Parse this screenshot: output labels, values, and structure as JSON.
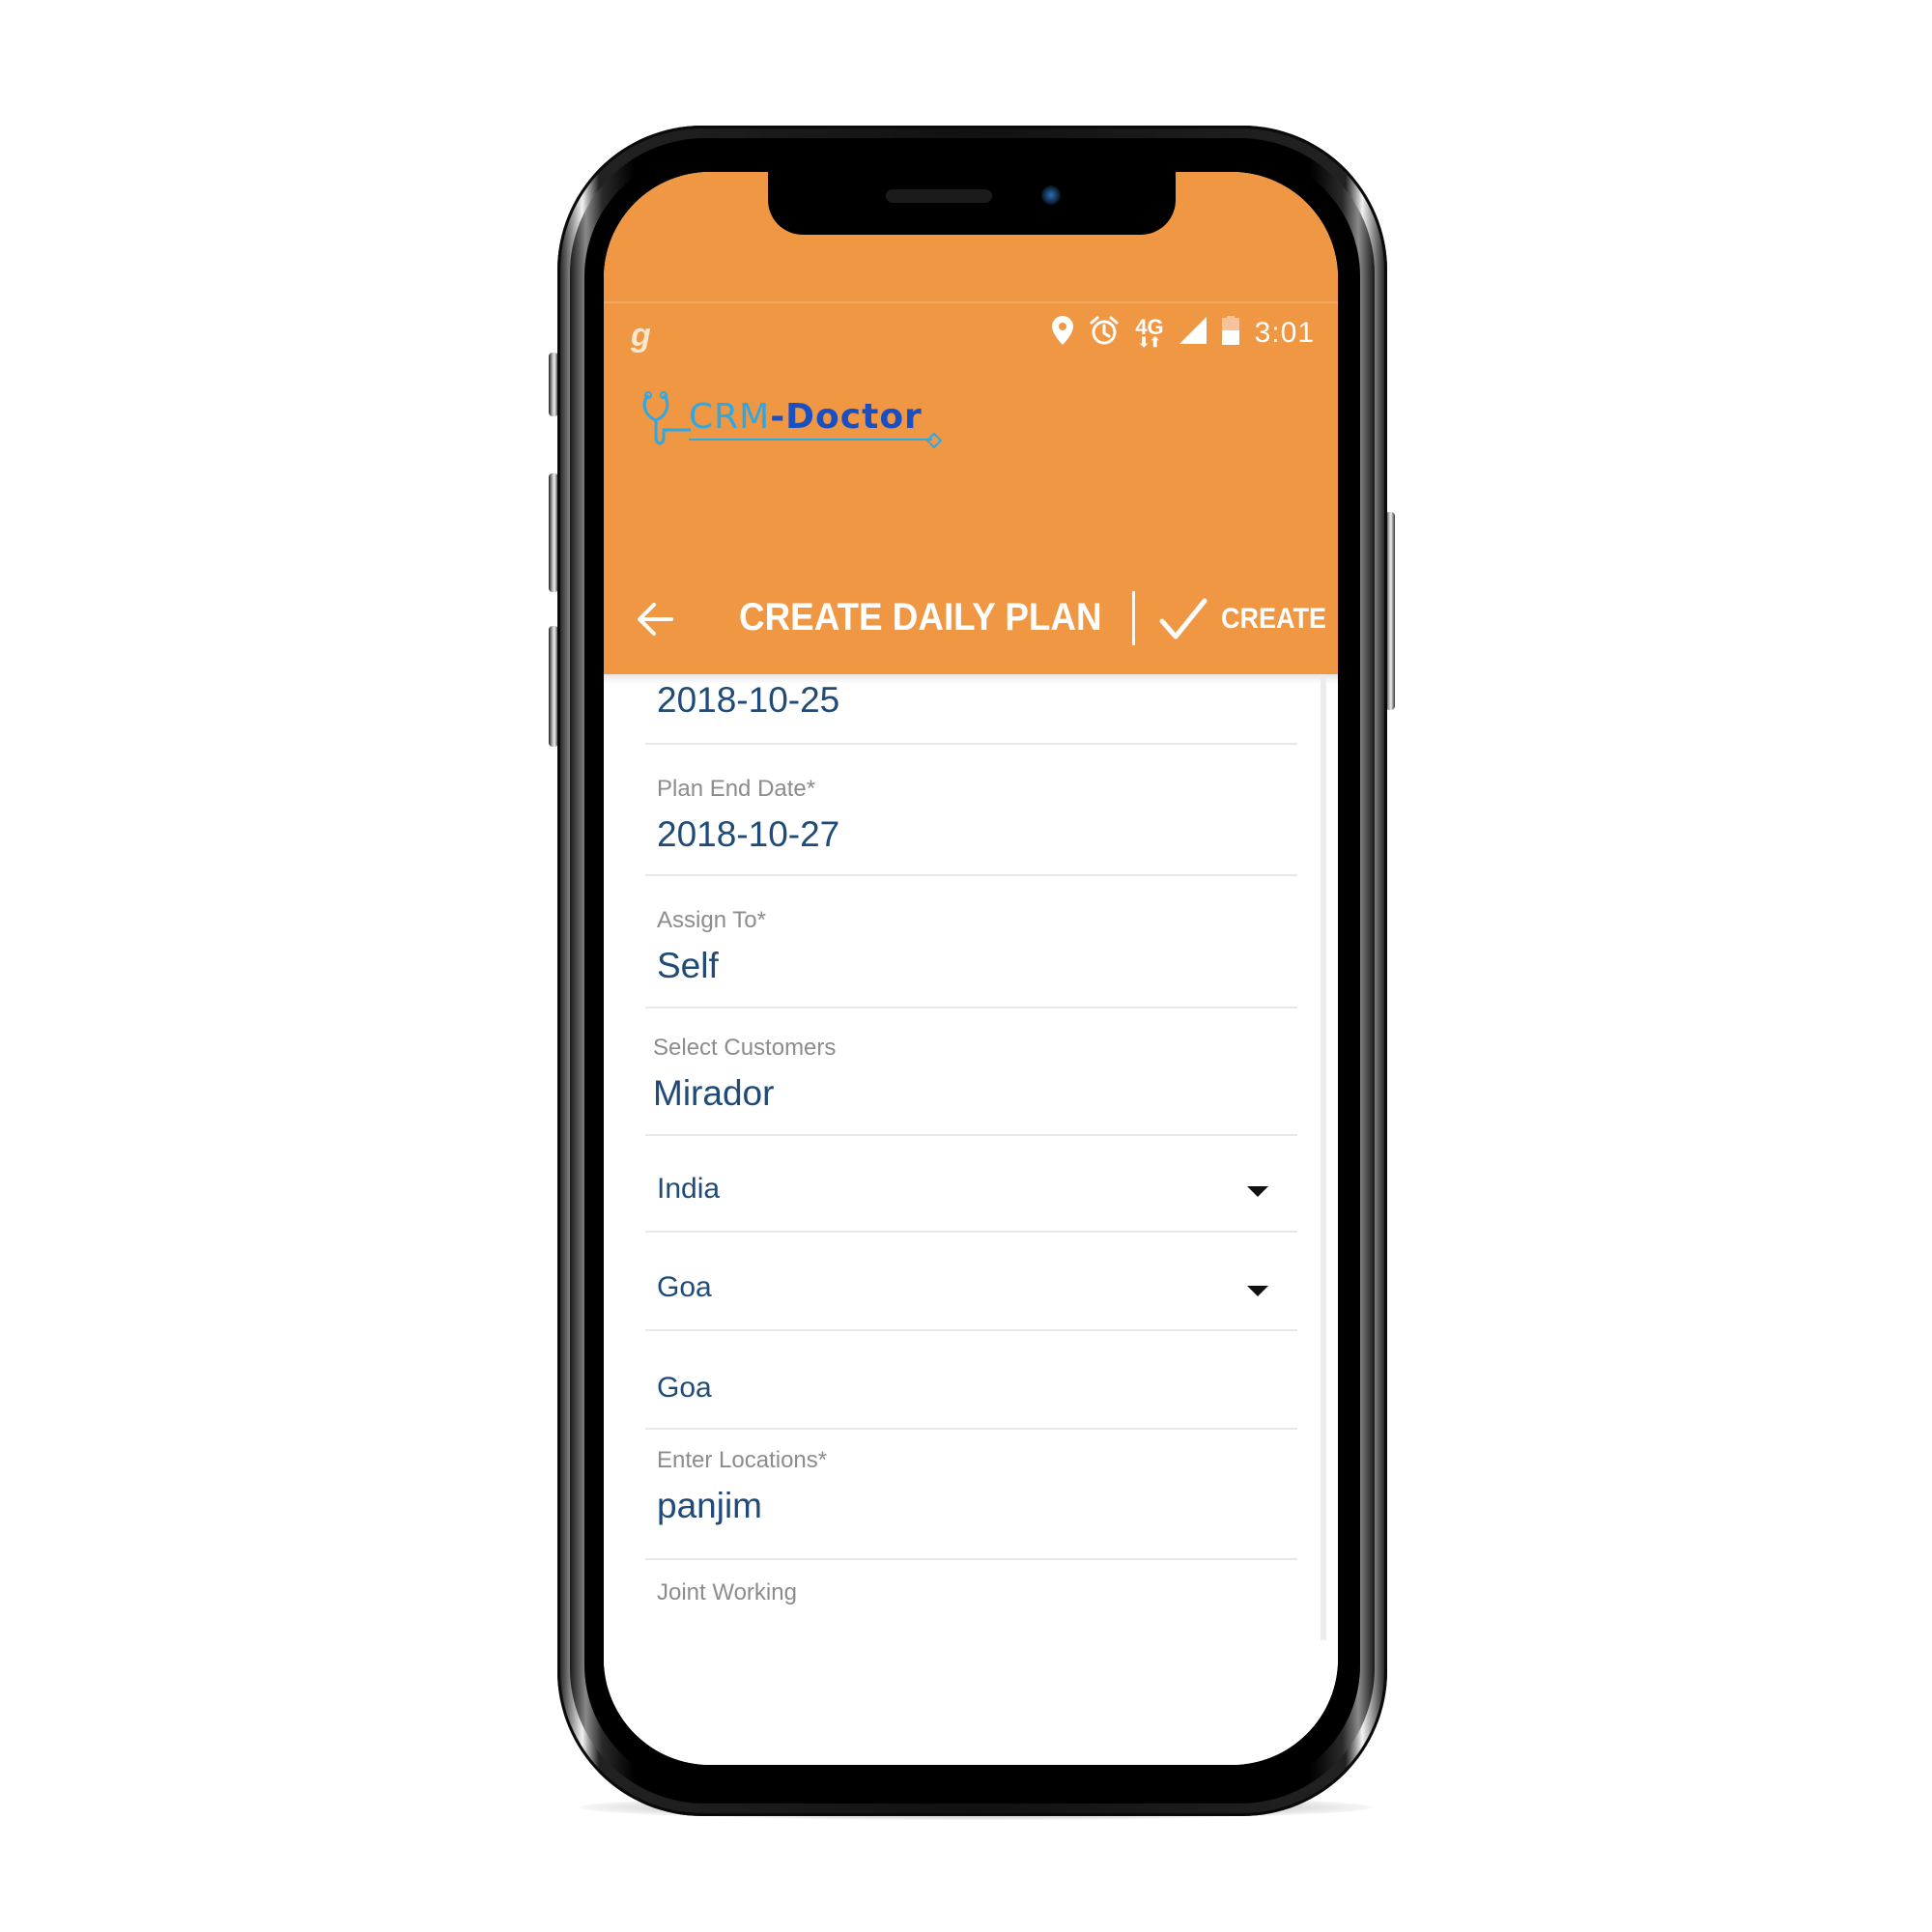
{
  "status_bar": {
    "left_app_glyph": "g",
    "icons": [
      "location-icon",
      "alarm-icon",
      "4g-data-icon",
      "signal-icon",
      "battery-icon"
    ],
    "network_label": "4G",
    "time": "3:01"
  },
  "header": {
    "logo": {
      "part1": "CRM",
      "part2": "-Doctor",
      "icon": "stethoscope-icon"
    },
    "background_color": "#f09744"
  },
  "toolbar": {
    "back_icon": "arrow-left-icon",
    "title": "CREATE DAILY PLAN",
    "create_icon": "check-icon",
    "create_label": "CREATE"
  },
  "form": {
    "plan_start_date": {
      "value": "2018-10-25"
    },
    "plan_end_date": {
      "label": "Plan End Date*",
      "value": "2018-10-27"
    },
    "assign_to": {
      "label": "Assign To*",
      "value": "Self"
    },
    "select_customers": {
      "label": "Select Customers",
      "value": "Mirador"
    },
    "country": {
      "value": "India"
    },
    "state": {
      "value": "Goa"
    },
    "city": {
      "value": "Goa"
    },
    "locations": {
      "label": "Enter Locations*",
      "value": "panjim"
    },
    "joint_working": {
      "label": "Joint Working"
    }
  },
  "colors": {
    "accent": "#f09744",
    "value_text": "#204a78",
    "label_text": "#8c8c8c"
  }
}
